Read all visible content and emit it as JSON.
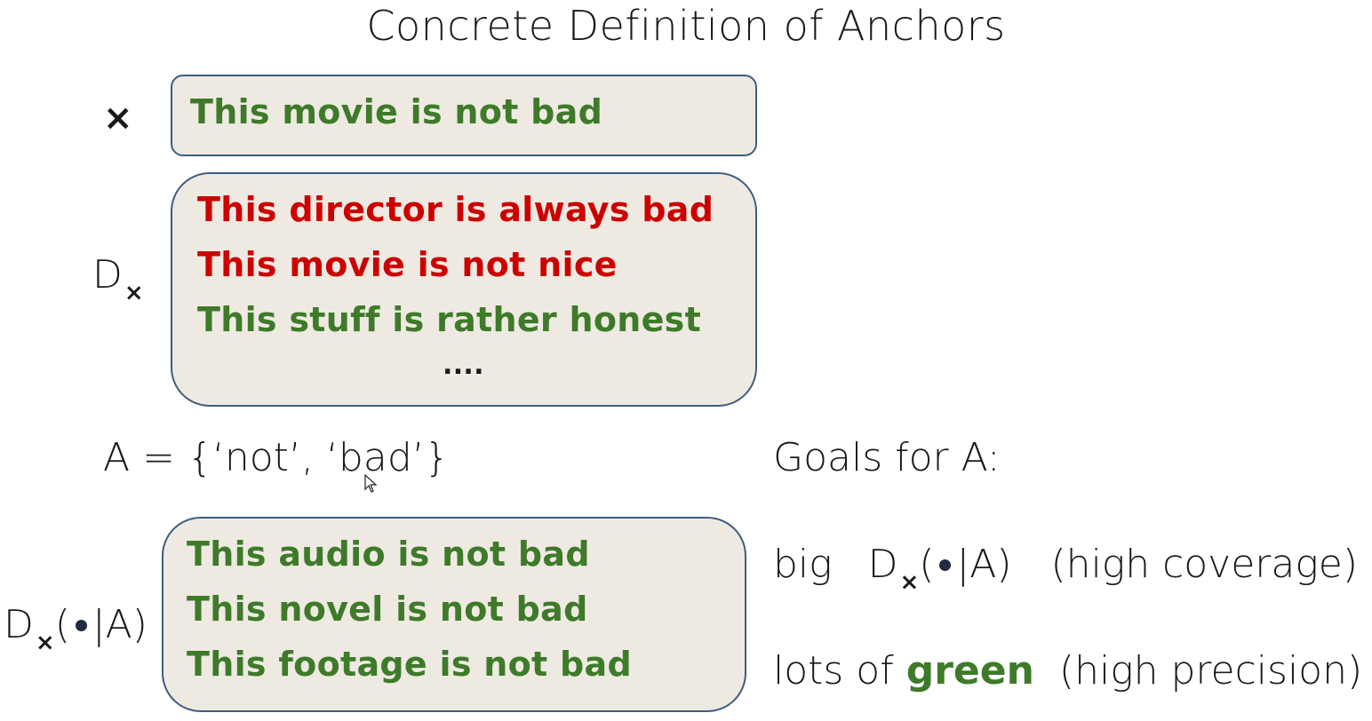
{
  "title": "Concrete Definition of Anchors",
  "x_label": "×",
  "x_box": {
    "text": "This movie is not bad"
  },
  "dx_label": {
    "main": "D",
    "sub": "×"
  },
  "dx_box": {
    "lines": [
      {
        "text": "This director is always bad",
        "color": "red"
      },
      {
        "text": "This movie is not nice",
        "color": "red"
      },
      {
        "text": "This stuff is rather honest",
        "color": "green"
      }
    ],
    "ellipsis": "...."
  },
  "anchor_def": "A = {‘not’, ‘bad’}",
  "dxa_label": {
    "main": "D",
    "sub": "×",
    "rest": "(",
    "bar": "|A)"
  },
  "dxa_box": {
    "lines": [
      {
        "text": "This audio is not bad",
        "color": "green"
      },
      {
        "text": "This novel is not bad",
        "color": "green"
      },
      {
        "text": "This footage is not bad",
        "color": "green"
      }
    ]
  },
  "goals": {
    "heading": "Goals for A:",
    "goal1": {
      "prefix": "big",
      "d": "D",
      "sub": "×",
      "open": "(",
      "close": "|A)",
      "note": "(high coverage)"
    },
    "goal2": {
      "prefix": "lots of",
      "highlight": "green",
      "note": "(high precision)"
    }
  },
  "colors": {
    "green": "#3e7a2a",
    "red": "#cc0000",
    "box_fill": "#eeeae2",
    "box_border": "#3f5d80"
  }
}
